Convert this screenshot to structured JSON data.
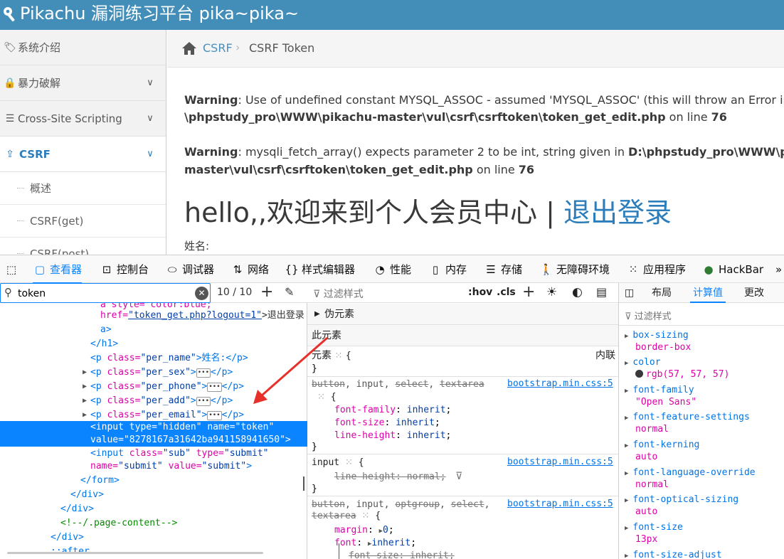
{
  "header": {
    "title": "Pikachu 漏洞练习平台 pika~pika~",
    "icon": "wrench-icon"
  },
  "sidebar": {
    "items": [
      {
        "label": "系统介绍",
        "icon": "tags-icon"
      },
      {
        "label": "暴力破解",
        "icon": "lock-icon"
      },
      {
        "label": "Cross-Site Scripting",
        "icon": "list-icon"
      },
      {
        "label": "CSRF",
        "icon": "share-icon"
      }
    ],
    "sub": [
      "概述",
      "CSRF(get)",
      "CSRF(post)"
    ]
  },
  "breadcrumb": {
    "level1": "CSRF",
    "level2": "CSRF Token"
  },
  "content": {
    "w1_label": "Warning",
    "w1_text": ": Use of undefined constant MYSQL_ASSOC - assumed 'MYSQL_ASSOC' (this will throw an Error in a future version of PHP) in D:",
    "w1_path": "\\phpstudy_pro\\WWW\\pikachu-master\\vul\\csrf\\csrftoken\\token_get_edit.php",
    "w1_on": " on line ",
    "w1_line": "76",
    "w2_label": "Warning",
    "w2_text": ": mysqli_fetch_array() expects parameter 2 to be int, string given in ",
    "w2_path1": "D:\\phpstudy_pro\\WWW\\pikachu-",
    "w2_path2": "master\\vul\\csrf\\csrftoken\\token_get_edit.php",
    "w2_on": " on line ",
    "w2_line": "76",
    "hello": "hello,,欢迎来到个人会员中心",
    "sep": "|",
    "logout": "退出登录",
    "name_label": "姓名:"
  },
  "devtools": {
    "tabs": [
      {
        "label": "",
        "icon": "pick-element-icon"
      },
      {
        "label": "查看器",
        "icon": "inspector-icon"
      },
      {
        "label": "控制台",
        "icon": "console-icon"
      },
      {
        "label": "调试器",
        "icon": "debugger-icon"
      },
      {
        "label": "网络",
        "icon": "network-icon"
      },
      {
        "label": "样式编辑器",
        "icon": "braces-icon"
      },
      {
        "label": "性能",
        "icon": "gauge-icon"
      },
      {
        "label": "内存",
        "icon": "memory-icon"
      },
      {
        "label": "存储",
        "icon": "storage-icon"
      },
      {
        "label": "无障碍环境",
        "icon": "accessibility-icon"
      },
      {
        "label": "应用程序",
        "icon": "grid-icon"
      },
      {
        "label": "HackBar",
        "icon": "hackbar-icon"
      }
    ],
    "search": {
      "value": "token",
      "count": "10 / 10"
    },
    "tree": {
      "l0_attr": "a style=\"color:blue;\"",
      "l1_href": "href=",
      "l1_val": "\"token_get.php?logout=1\"",
      "l1_text": ">退出登录",
      "l2": "a>",
      "l3": "</h1>",
      "l4_open": "<p ",
      "l4_attr": "class=",
      "l4_val": "\"per_name\"",
      "l4_text": ">姓名:</p>",
      "l5_val": "\"per_sex\"",
      "l6_val": "\"per_phone\"",
      "l7_val": "\"per_add\"",
      "l8_val": "\"per_email\"",
      "sel1": "<input type=\"hidden\" name=\"token\"",
      "sel2": "value=\"8278167a31642ba941158941650\">",
      "in1_tag": "<input ",
      "in1_a1": "class=",
      "in1_v1": "\"sub\"",
      "in1_a2": " type=",
      "in1_v2": "\"submit\"",
      "in2_a1": "name=",
      "in2_v1": "\"submit\"",
      "in2_a2": " value=",
      "in2_v2": "\"submit\"",
      "in2_end": ">",
      "form_close": "</form>",
      "div_close": "</div>",
      "comment": "<!--/.page-content-->",
      "after": "::after"
    },
    "rules": {
      "filter_placeholder": "过滤样式",
      "hov": ":hov",
      "cls": ".cls",
      "pseudo": "伪元素",
      "this_element": "此元素",
      "element_label": "元素",
      "inline": "内联",
      "r1_sel_a": "button",
      "r1_sel_b": ", input, ",
      "r1_sel_c": "select",
      "r1_sel_d": ", ",
      "r1_sel_e": "textarea",
      "r1_src": "bootstrap.min.css:5",
      "r1_p1": "font-family",
      "r1_v1": "inherit",
      "r1_p2": "font-size",
      "r1_v2": "inherit",
      "r1_p3": "line-height",
      "r1_v3": "inherit",
      "r2_sel": "input",
      "r2_src": "bootstrap.min.css:5",
      "r2_p1": "line-height: normal;",
      "r3_sel_a": "button",
      "r3_sel_b": ", input, ",
      "r3_sel_c": "optgroup",
      "r3_sel_d": ", ",
      "r3_sel_e": "select",
      "r3_sel_f": ",",
      "r3_sel_g": "textarea",
      "r3_src": "bootstrap.min.css:5",
      "r3_p1": "margin",
      "r3_v1": "0",
      "r3_p2": "font",
      "r3_v2": "inherit",
      "r3_p3": "font-size: inherit;"
    },
    "computed": {
      "tabs": [
        "布局",
        "计算值",
        "更改"
      ],
      "filter_placeholder": "过滤样式",
      "props": [
        {
          "name": "box-sizing",
          "value": "border-box"
        },
        {
          "name": "color",
          "value": "rgb(57, 57, 57)"
        },
        {
          "name": "font-family",
          "value": "\"Open Sans\""
        },
        {
          "name": "font-feature-settings",
          "value": "normal"
        },
        {
          "name": "font-kerning",
          "value": "auto"
        },
        {
          "name": "font-language-override",
          "value": "normal"
        },
        {
          "name": "font-optical-sizing",
          "value": "auto"
        },
        {
          "name": "font-size",
          "value": "13px"
        },
        {
          "name": "font-size-adjust",
          "value": ""
        }
      ]
    }
  },
  "colors": {
    "header": "#438eb9",
    "accent": "#2b7dbc",
    "devtools_select": "#0a84ff",
    "annotation_arrow": "#e8302a"
  }
}
